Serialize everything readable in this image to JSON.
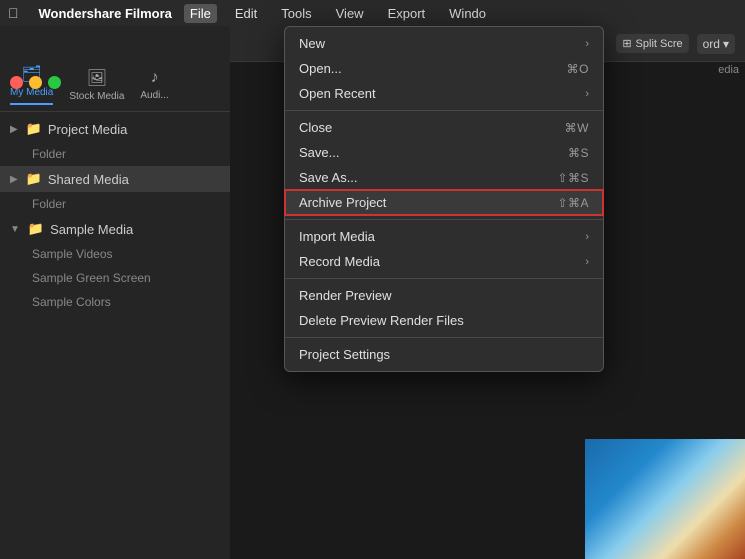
{
  "app": {
    "name": "Wondershare Filmora",
    "menu_items": [
      "File",
      "Edit",
      "Tools",
      "View",
      "Export",
      "Windo"
    ]
  },
  "menubar": {
    "apple_symbol": "",
    "active_menu": "File"
  },
  "traffic_lights": {
    "red": "#ff5f57",
    "yellow": "#febc2e",
    "green": "#28c840"
  },
  "tabs": [
    {
      "id": "my-media",
      "label": "My Media",
      "icon": "🗂",
      "active": true
    },
    {
      "id": "stock-media",
      "label": "Stock Media",
      "icon": "🖼"
    },
    {
      "id": "audio",
      "label": "Audi...",
      "icon": "♪"
    }
  ],
  "sidebar": {
    "items": [
      {
        "id": "project-media",
        "label": "Project Media",
        "icon": "📁",
        "level": 0,
        "has_chevron": true
      },
      {
        "id": "folder-1",
        "label": "Folder",
        "level": 1
      },
      {
        "id": "shared-media",
        "label": "Shared Media",
        "icon": "📁",
        "level": 0,
        "has_chevron": true,
        "selected": true
      },
      {
        "id": "folder-2",
        "label": "Folder",
        "level": 1
      },
      {
        "id": "sample-media",
        "label": "Sample Media",
        "icon": "📁",
        "level": 0,
        "has_chevron": true
      },
      {
        "id": "sample-videos",
        "label": "Sample Videos",
        "level": 1
      },
      {
        "id": "sample-green",
        "label": "Sample Green Screen",
        "level": 1
      },
      {
        "id": "sample-colors",
        "label": "Sample Colors",
        "level": 1
      }
    ]
  },
  "toolbar": {
    "split_screen_label": "Split Scre",
    "word_label": "ord",
    "media_label": "edia",
    "dropdown_arrow": "▾"
  },
  "dropdown": {
    "items": [
      {
        "id": "new",
        "label": "New",
        "shortcut": "",
        "has_arrow": true,
        "separator_after": false
      },
      {
        "id": "open",
        "label": "Open...",
        "shortcut": "⌘O",
        "has_arrow": false
      },
      {
        "id": "open-recent",
        "label": "Open Recent",
        "shortcut": "",
        "has_arrow": true,
        "separator_after": true
      },
      {
        "id": "close",
        "label": "Close",
        "shortcut": "⌘W",
        "has_arrow": false
      },
      {
        "id": "save",
        "label": "Save...",
        "shortcut": "⌘S",
        "has_arrow": false
      },
      {
        "id": "save-as",
        "label": "Save As...",
        "shortcut": "⇧⌘S",
        "has_arrow": false
      },
      {
        "id": "archive-project",
        "label": "Archive Project",
        "shortcut": "⇧⌘A",
        "has_arrow": false,
        "highlighted": true,
        "separator_after": true
      },
      {
        "id": "import-media",
        "label": "Import Media",
        "shortcut": "",
        "has_arrow": true
      },
      {
        "id": "record-media",
        "label": "Record Media",
        "shortcut": "",
        "has_arrow": true,
        "separator_after": true
      },
      {
        "id": "render-preview",
        "label": "Render Preview",
        "shortcut": "",
        "has_arrow": false
      },
      {
        "id": "delete-preview",
        "label": "Delete Preview Render Files",
        "shortcut": "",
        "has_arrow": false,
        "separator_after": true
      },
      {
        "id": "project-settings",
        "label": "Project Settings",
        "shortcut": "",
        "has_arrow": false
      }
    ]
  }
}
